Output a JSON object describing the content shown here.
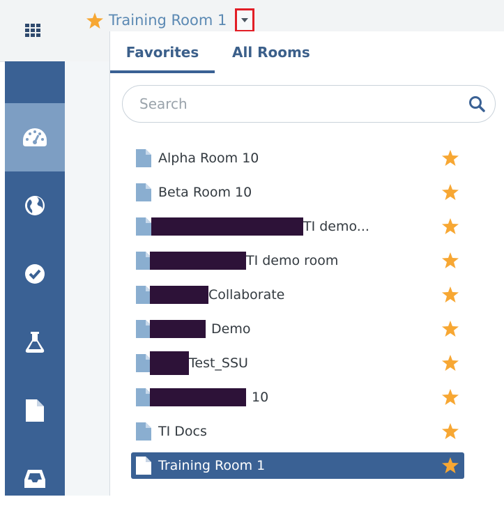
{
  "header": {
    "room_title": "Training Room 1",
    "apps_icon": "grid-icon",
    "favorite_icon": "star-icon",
    "dropdown_icon": "caret-down-icon"
  },
  "sidebar": {
    "items": [
      {
        "icon": "dashboard-icon",
        "active": true
      },
      {
        "icon": "globe-icon",
        "active": false
      },
      {
        "icon": "check-circle-icon",
        "active": false
      },
      {
        "icon": "flask-icon",
        "active": false
      },
      {
        "icon": "document-icon",
        "active": false
      },
      {
        "icon": "inbox-icon",
        "active": false
      }
    ]
  },
  "dropdown": {
    "tabs": [
      {
        "label": "Favorites",
        "active": true
      },
      {
        "label": "All Rooms",
        "active": false
      }
    ],
    "search": {
      "placeholder": "Search",
      "value": ""
    },
    "rooms": [
      {
        "label": "Alpha Room 10",
        "favorite": true,
        "selected": false
      },
      {
        "label": "Beta Room 10",
        "favorite": true,
        "selected": false
      },
      {
        "label": "TI demo...",
        "favorite": true,
        "selected": false
      },
      {
        "label": "TI demo room",
        "favorite": true,
        "selected": false
      },
      {
        "label": "Collaborate",
        "favorite": true,
        "selected": false
      },
      {
        "label": "Demo",
        "favorite": true,
        "selected": false
      },
      {
        "label": "Test_SSU",
        "favorite": true,
        "selected": false
      },
      {
        "label": "10",
        "favorite": true,
        "selected": false
      },
      {
        "label": "TI Docs",
        "favorite": true,
        "selected": false
      },
      {
        "label": "Training Room 1",
        "favorite": true,
        "selected": true
      }
    ]
  },
  "colors": {
    "accent": "#3a6194",
    "star": "#f7a733",
    "highlight": "#e21e26"
  }
}
